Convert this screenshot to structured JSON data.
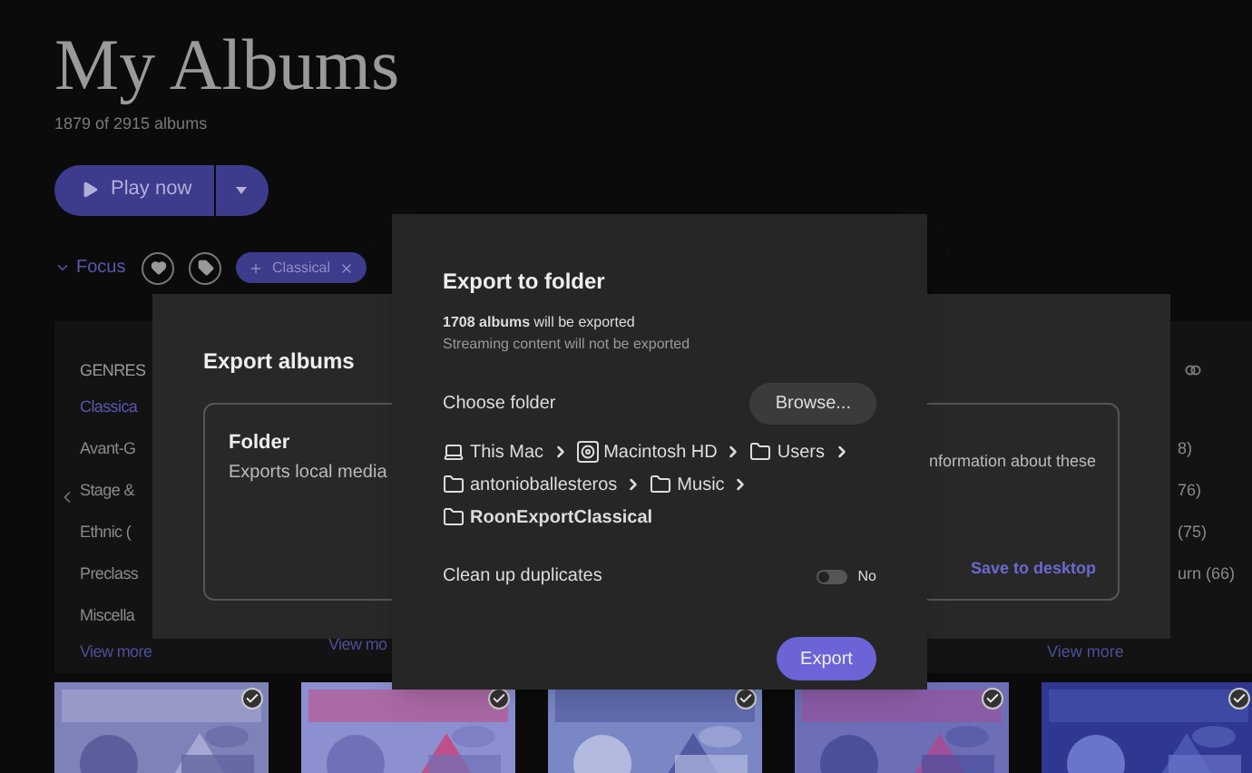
{
  "page": {
    "title": "My Albums",
    "count": "1879 of 2915 albums"
  },
  "play_button": {
    "label": "Play now"
  },
  "focus": {
    "label": "Focus"
  },
  "filter_chips": [
    {
      "label": "Classical"
    }
  ],
  "genres_panel": {
    "heading": "GENRES",
    "items": [
      {
        "label": "Classica",
        "selected": true
      },
      {
        "label": "Avant-G",
        "selected": false
      },
      {
        "label": "Stage &",
        "selected": false
      },
      {
        "label": "Ethnic (",
        "selected": false
      },
      {
        "label": "Preclass",
        "selected": false
      },
      {
        "label": "Miscella",
        "selected": false
      }
    ],
    "view_more": "View more"
  },
  "middle_panel": {
    "view_more": "View mo"
  },
  "right_panel": {
    "items": [
      "8)",
      "76)",
      "(75)",
      "urn (66)"
    ],
    "view_more": "View more"
  },
  "albums": [
    {
      "checked": true
    },
    {
      "checked": true
    },
    {
      "checked": true
    },
    {
      "checked": true
    },
    {
      "checked": true
    }
  ],
  "export_albums": {
    "title": "Export albums",
    "options": [
      {
        "title": "Folder",
        "description": "Exports local media",
        "fragment": "nformation about these",
        "action": "Save to desktop"
      }
    ]
  },
  "export_to_folder": {
    "title": "Export to folder",
    "summary": "**1708 albums** will be exported",
    "note": "Streaming content will not be exported",
    "choose_label": "Choose folder",
    "browse": "Browse...",
    "path": [
      {
        "kind": "computer",
        "label": "This Mac"
      },
      {
        "kind": "drive",
        "label": "Macintosh HD"
      },
      {
        "kind": "folder",
        "label": "Users"
      },
      {
        "kind": "folder",
        "label": "antonioballesteros"
      },
      {
        "kind": "folder",
        "label": "Music"
      },
      {
        "kind": "folder",
        "label": "RoonExportClassical"
      }
    ],
    "cleanup": {
      "label": "Clean up duplicates",
      "on": false,
      "value": "No"
    },
    "export_button": "Export"
  }
}
